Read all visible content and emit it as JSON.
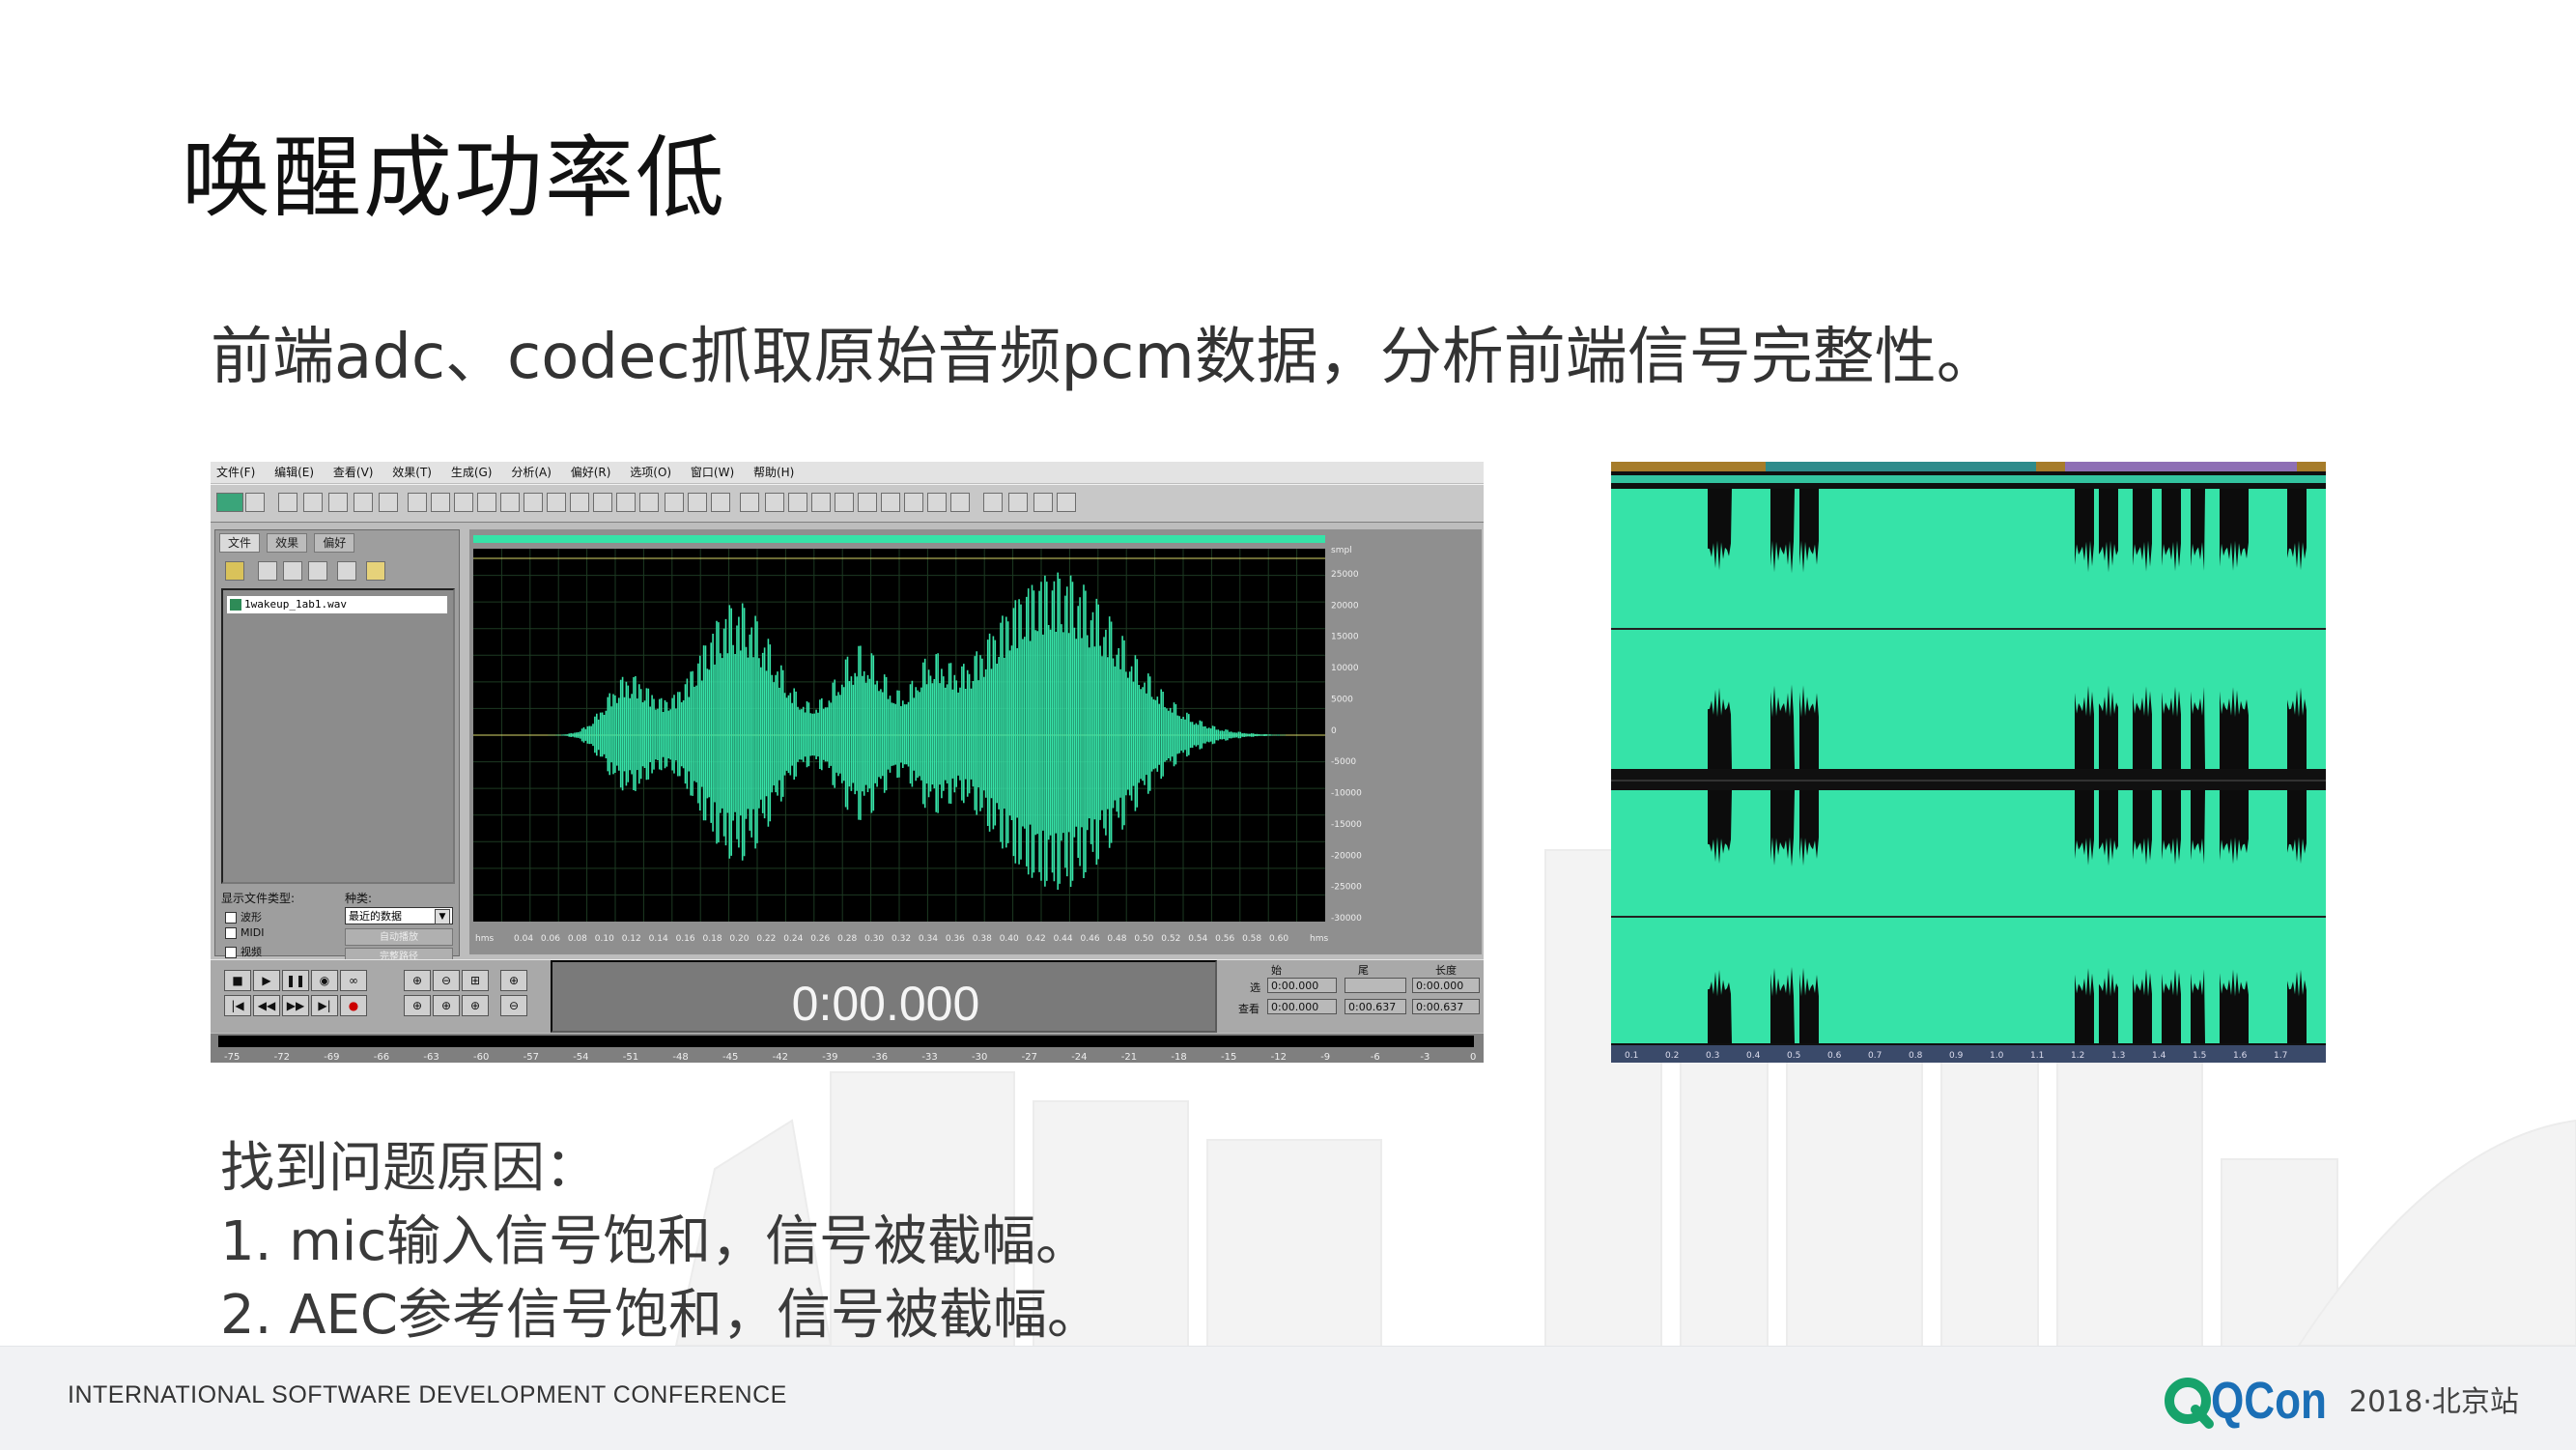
{
  "slide": {
    "title": "唤醒成功率低",
    "subtitle": "前端adc、codec抓取原始音频pcm数据，分析前端信号完整性。",
    "findings": [
      "找到问题原因：",
      "1. mic输入信号饱和，信号被截幅。",
      "2. AEC参考信号饱和，信号被截幅。"
    ]
  },
  "footer": {
    "conference": "INTERNATIONAL SOFTWARE DEVELOPMENT CONFERENCE",
    "brand": "QCon",
    "event": "2018·北京站"
  },
  "colors": {
    "waveform": "#36e3a8",
    "qcon_green": "#17a36b",
    "qcon_blue": "#1b6fb6"
  },
  "audio_editor": {
    "menu": [
      "文件(F)",
      "编辑(E)",
      "查看(V)",
      "效果(T)",
      "生成(G)",
      "分析(A)",
      "偏好(R)",
      "选项(O)",
      "窗口(W)",
      "帮助(H)"
    ],
    "side_tabs": [
      "文件",
      "效果",
      "偏好"
    ],
    "file_name": "1wakeup_1ab1.wav",
    "file_type_label": "显示文件类型:",
    "file_types": [
      "波形",
      "MIDI",
      "视频"
    ],
    "kind_label": "种类:",
    "kind_value": "最近的数据",
    "kind_buttons": [
      "自动播放",
      "完整路径"
    ],
    "time_display": "0:00.000",
    "selection_headers": [
      "始",
      "尾",
      "长度"
    ],
    "selection_row_labels": [
      "选",
      "查看"
    ],
    "selection_values": [
      [
        "0:00.000",
        "",
        "0:00.000"
      ],
      [
        "0:00.000",
        "0:00.637",
        "0:00.637"
      ]
    ],
    "y_unit": "smpl",
    "y_ticks": [
      "25000",
      "20000",
      "15000",
      "10000",
      "5000",
      "0",
      "-5000",
      "-10000",
      "-15000",
      "-20000",
      "-25000",
      "-30000"
    ],
    "x_unit": "hms",
    "x_ticks": [
      "0.04",
      "0.06",
      "0.08",
      "0.10",
      "0.12",
      "0.14",
      "0.16",
      "0.18",
      "0.20",
      "0.22",
      "0.24",
      "0.26",
      "0.28",
      "0.30",
      "0.32",
      "0.34",
      "0.36",
      "0.38",
      "0.40",
      "0.42",
      "0.44",
      "0.46",
      "0.48",
      "0.50",
      "0.52",
      "0.54",
      "0.56",
      "0.58",
      "0.60"
    ],
    "level_ticks": [
      "-75",
      "-72",
      "-69",
      "-66",
      "-63",
      "-60",
      "-57",
      "-54",
      "-51",
      "-48",
      "-45",
      "-42",
      "-39",
      "-36",
      "-33",
      "-30",
      "-27",
      "-24",
      "-21",
      "-18",
      "-15",
      "-12",
      "-9",
      "-6",
      "-3",
      "0"
    ]
  },
  "zoom_waveform": {
    "x_ticks": [
      "0.1",
      "0.2",
      "0.3",
      "0.4",
      "0.5",
      "0.6",
      "0.7",
      "0.8",
      "0.9",
      "1.0",
      "1.1",
      "1.2",
      "1.3",
      "1.4",
      "1.5",
      "1.6",
      "1.7"
    ]
  }
}
